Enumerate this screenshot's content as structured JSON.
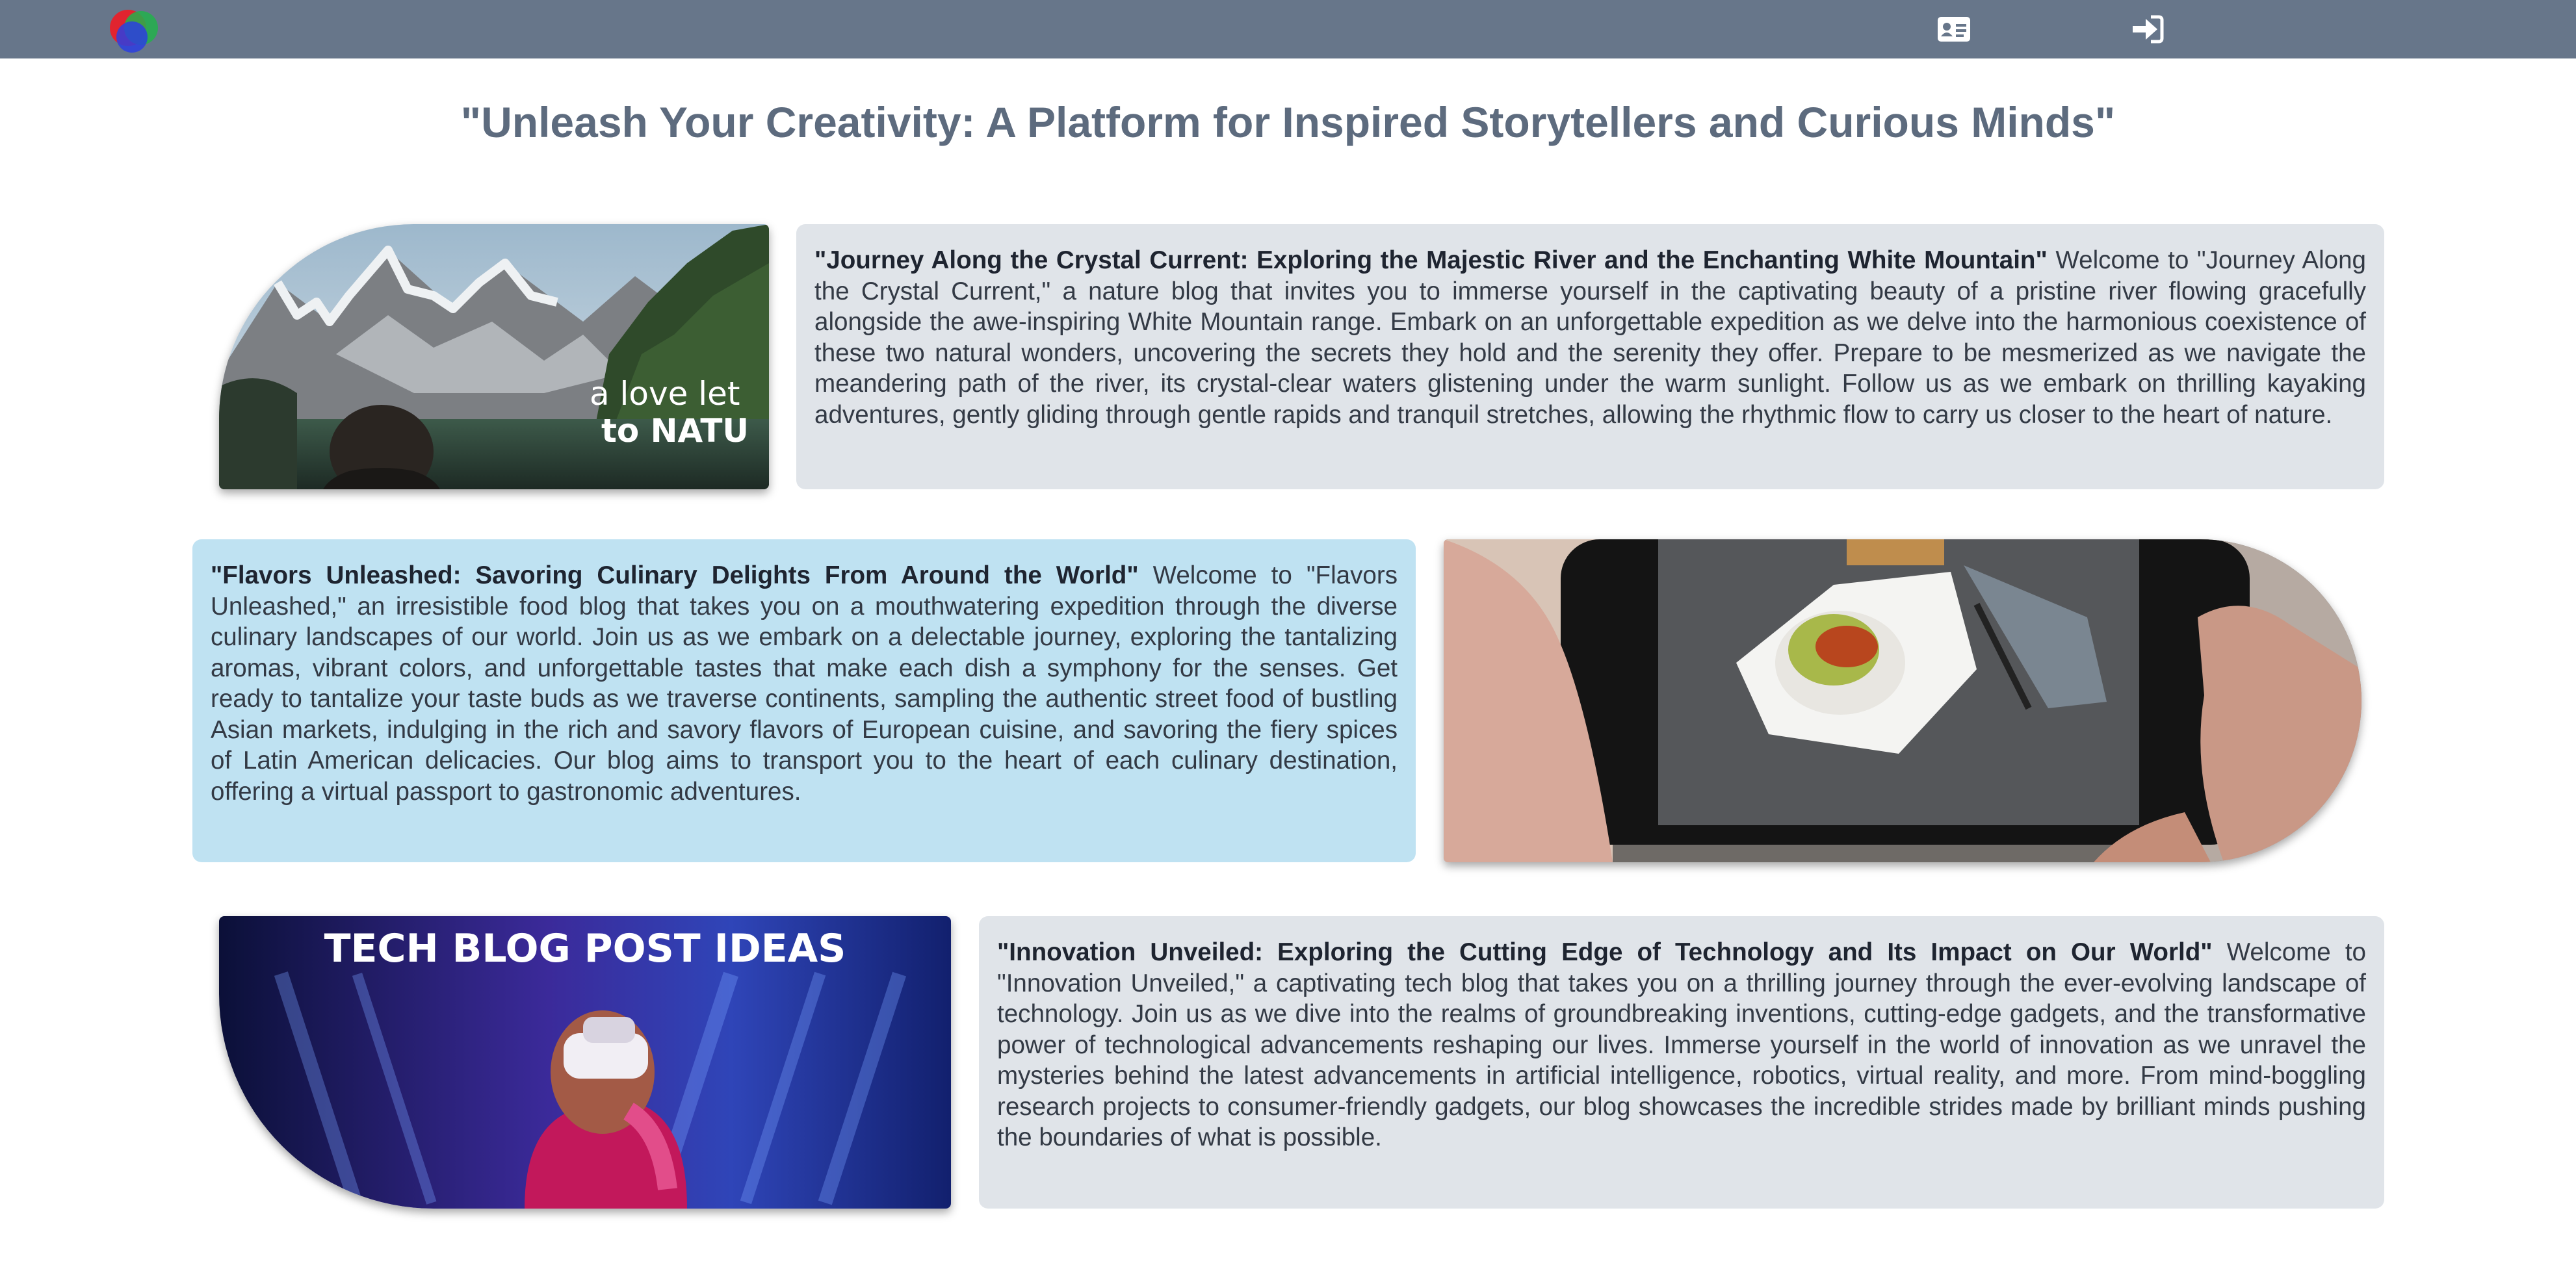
{
  "navbar": {
    "logo_icon": "three-circles-logo",
    "contact_icon": "id-card-icon",
    "login_icon": "sign-in-icon",
    "background": "#67768a"
  },
  "page_title": "\"Unleash Your Creativity: A Platform for Inspired Storytellers and Curious Minds\"",
  "posts": [
    {
      "title": "\"Journey Along the Crystal Current: Exploring the Majestic River and the Enchanting White Mountain\"",
      "body": " Welcome to \"Journey Along the Crystal Current,\" a nature blog that invites you to immerse yourself in the captivating beauty of a pristine river flowing gracefully alongside the awe-inspiring White Mountain range. Embark on an unforgettable expedition as we delve into the harmonious coexistence of these two natural wonders, uncovering the secrets they hold and the serenity they offer. Prepare to be mesmerized as we navigate the meandering path of the river, its crystal-clear waters glistening under the warm sunlight. Follow us as we embark on thrilling kayaking adventures, gently gliding through gentle rapids and tranquil stretches, allowing the rhythmic flow to carry us closer to the heart of nature.",
      "image_text_line1": "a love let",
      "image_text_line2": "to NATU",
      "card_color": "#e0e4e9"
    },
    {
      "title": "\"Flavors Unleashed: Savoring Culinary Delights From Around the World\"",
      "body": " Welcome to \"Flavors Unleashed,\" an irresistible food blog that takes you on a mouthwatering expedition through the diverse culinary landscapes of our world. Join us as we embark on a delectable journey, exploring the tantalizing aromas, vibrant colors, and unforgettable tastes that make each dish a symphony for the senses. Get ready to tantalize your taste buds as we traverse continents, sampling the authentic street food of bustling Asian markets, indulging in the rich and savory flavors of European cuisine, and savoring the fiery spices of Latin American delicacies. Our blog aims to transport you to the heart of each culinary destination, offering a virtual passport to gastronomic adventures.",
      "card_color": "#bfe2f2"
    },
    {
      "title": "\"Innovation Unveiled: Exploring the Cutting Edge of Technology and Its Impact on Our World\"",
      "body": " Welcome to \"Innovation Unveiled,\" a captivating tech blog that takes you on a thrilling journey through the ever-evolving landscape of technology. Join us as we dive into the realms of groundbreaking inventions, cutting-edge gadgets, and the transformative power of technological advancements reshaping our lives. Immerse yourself in the world of innovation as we unravel the mysteries behind the latest advancements in artificial intelligence, robotics, virtual reality, and more. From mind-boggling research projects to consumer-friendly gadgets, our blog showcases the incredible strides made by brilliant minds pushing the boundaries of what is possible.",
      "image_text": "TECH BLOG POST IDEAS",
      "card_color": "#e0e4e9"
    }
  ]
}
